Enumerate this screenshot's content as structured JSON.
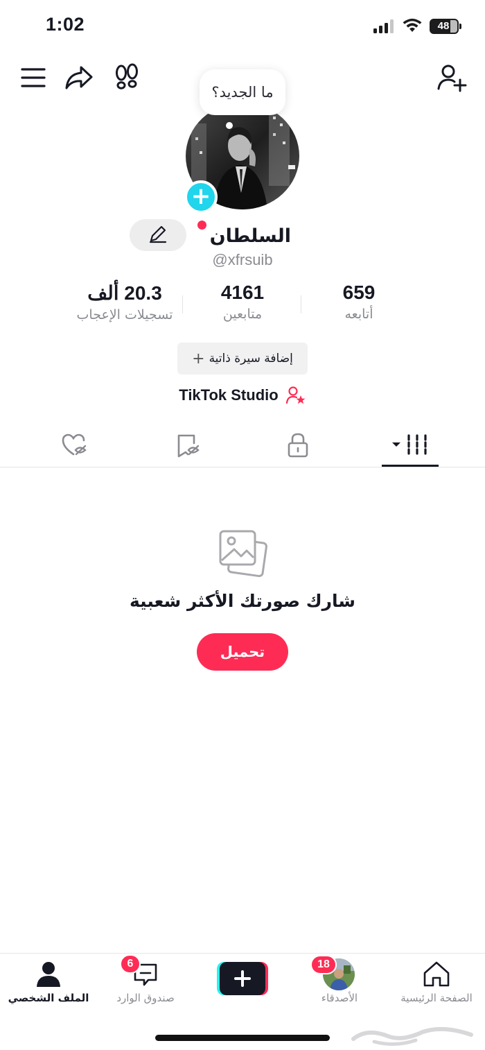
{
  "status_bar": {
    "time": "1:02",
    "battery": "48"
  },
  "top_bar": {
    "bubble_text": "ما الجديد؟"
  },
  "profile": {
    "display_name": "السلطان",
    "username": "@xfrsuib"
  },
  "stats": [
    {
      "value": "20.3 ألف",
      "label": "تسجيلات الإعجاب"
    },
    {
      "value": "4161",
      "label": "متابعين"
    },
    {
      "value": "659",
      "label": "أتابعه"
    }
  ],
  "bio_button": {
    "label": "إضافة سيرة ذاتية",
    "icon": "+"
  },
  "studio": {
    "label": "TikTok Studio"
  },
  "empty_state": {
    "title": "شارك صورتك الأكثر شعبية",
    "upload_label": "تحميل"
  },
  "bottom_nav": {
    "profile": "الملف الشخصي",
    "inbox": "صندوق الوارد",
    "inbox_badge": "6",
    "friends": "الأصدقاء",
    "friends_badge": "18",
    "home": "الصفحة الرئيسية"
  },
  "colors": {
    "accent": "#fe2c55",
    "cyan": "#20d5ec",
    "text": "#161823",
    "muted": "#8a8b91"
  }
}
